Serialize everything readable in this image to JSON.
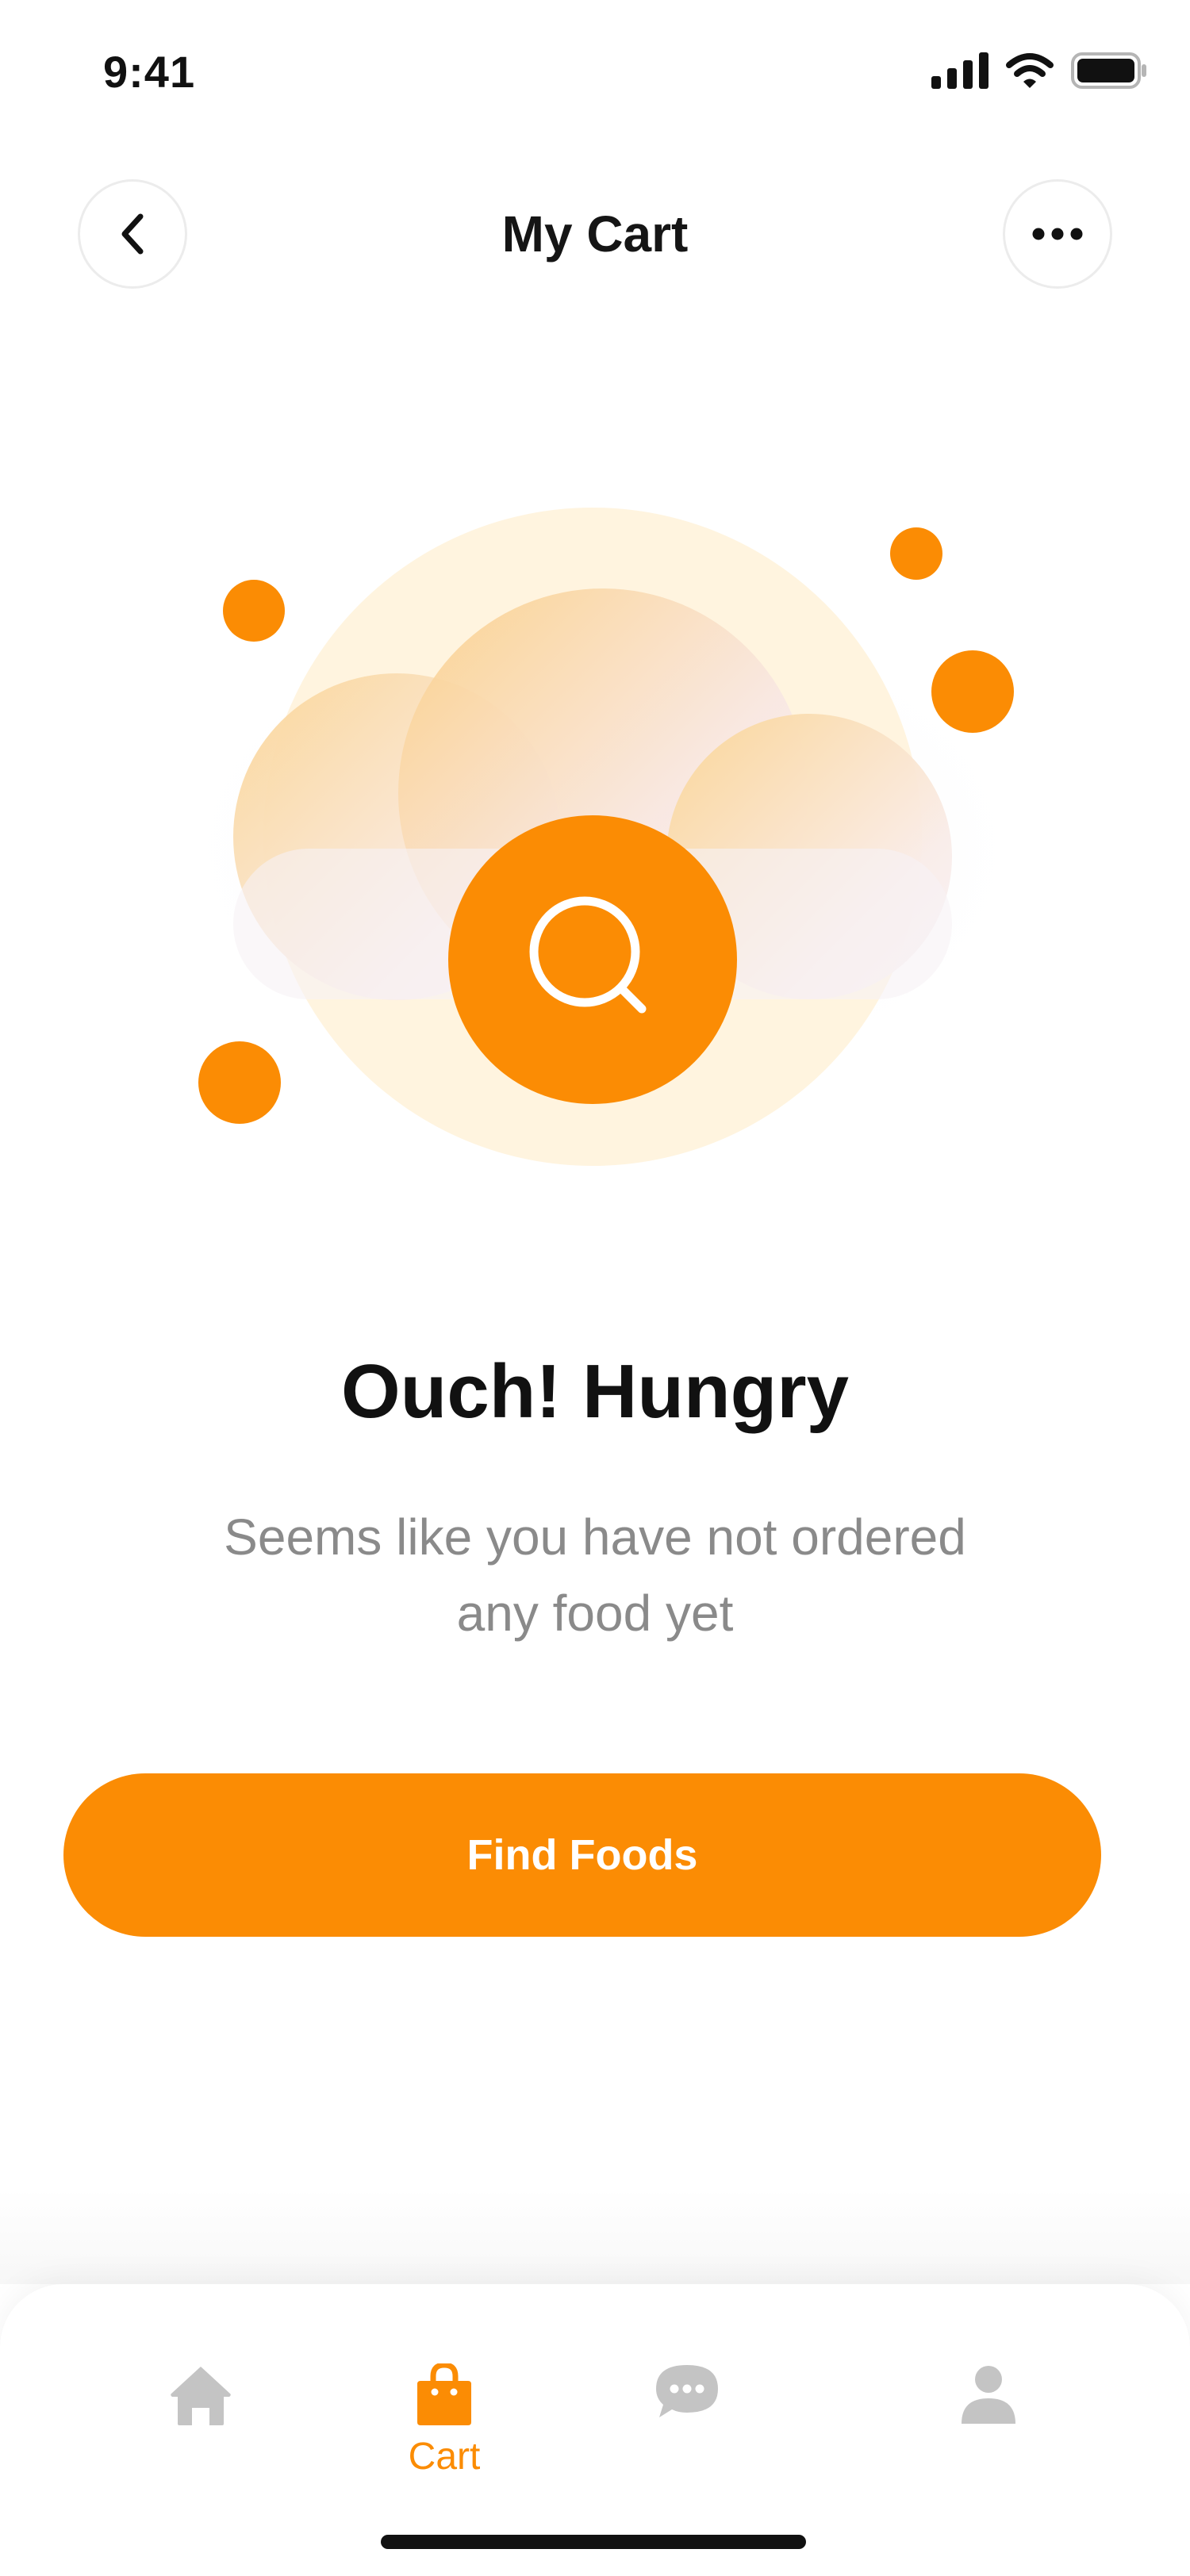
{
  "status_bar": {
    "time": "9:41"
  },
  "header": {
    "title": "My Cart",
    "back_icon": "chevron-left-icon",
    "more_icon": "more-horizontal-icon"
  },
  "empty_state": {
    "illustration_icon": "search-icon",
    "title": "Ouch! Hungry",
    "subtitle_line1": "Seems like you have not ordered",
    "subtitle_line2": "any food yet"
  },
  "cta": {
    "label": "Find Foods"
  },
  "bottom_nav": {
    "items": [
      {
        "icon": "home-icon",
        "label": "",
        "active": false
      },
      {
        "icon": "shopping-bag-icon",
        "label": "Cart",
        "active": true
      },
      {
        "icon": "chat-icon",
        "label": "",
        "active": false
      },
      {
        "icon": "profile-icon",
        "label": "",
        "active": false
      }
    ]
  },
  "colors": {
    "accent": "#fb8c04",
    "inactive_icon": "#c4c4c4",
    "title_text": "#111111",
    "subtitle_text": "#8a8a8a"
  }
}
